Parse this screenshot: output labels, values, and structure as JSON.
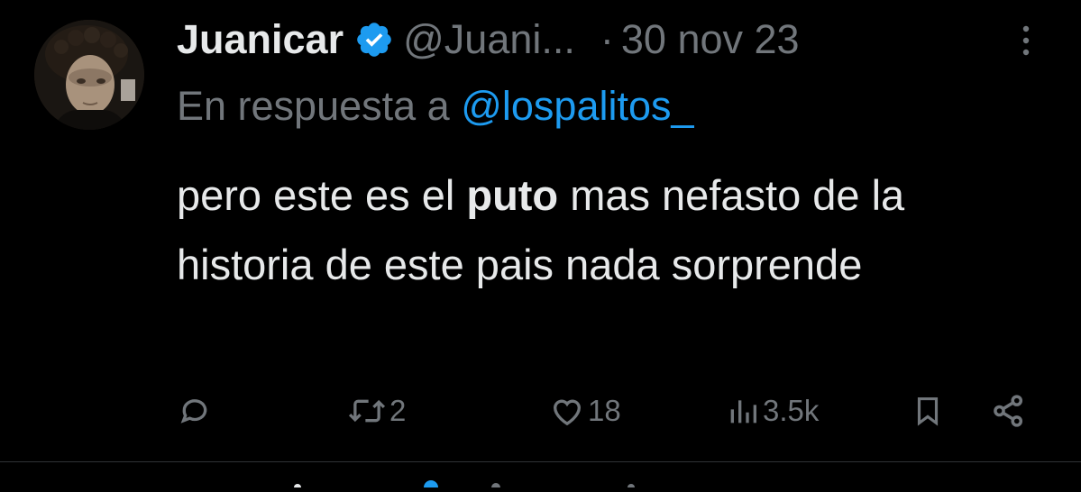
{
  "tweet": {
    "author_name": "Juanicar",
    "verified": true,
    "handle": "@Juani...",
    "separator": "·",
    "date": "30 nov 23",
    "reply_prefix": "En respuesta a",
    "reply_to": "@lospalitos_",
    "text_before": "pero este es el ",
    "text_bold": "puto",
    "text_after": " mas nefasto de la historia de este pais nada sorprende",
    "actions": {
      "reply": {
        "icon": "reply-icon",
        "count": ""
      },
      "retweet": {
        "icon": "retweet-icon",
        "count": "2"
      },
      "like": {
        "icon": "heart-icon",
        "count": "18"
      },
      "views": {
        "icon": "views-icon",
        "count": "3.5k"
      },
      "bookmark": {
        "icon": "bookmark-icon"
      },
      "share": {
        "icon": "share-icon"
      }
    }
  },
  "colors": {
    "background": "#000000",
    "text_primary": "#e7e9ea",
    "text_secondary": "#71767b",
    "accent_blue": "#1d9bf0",
    "divider": "#2f3336"
  }
}
